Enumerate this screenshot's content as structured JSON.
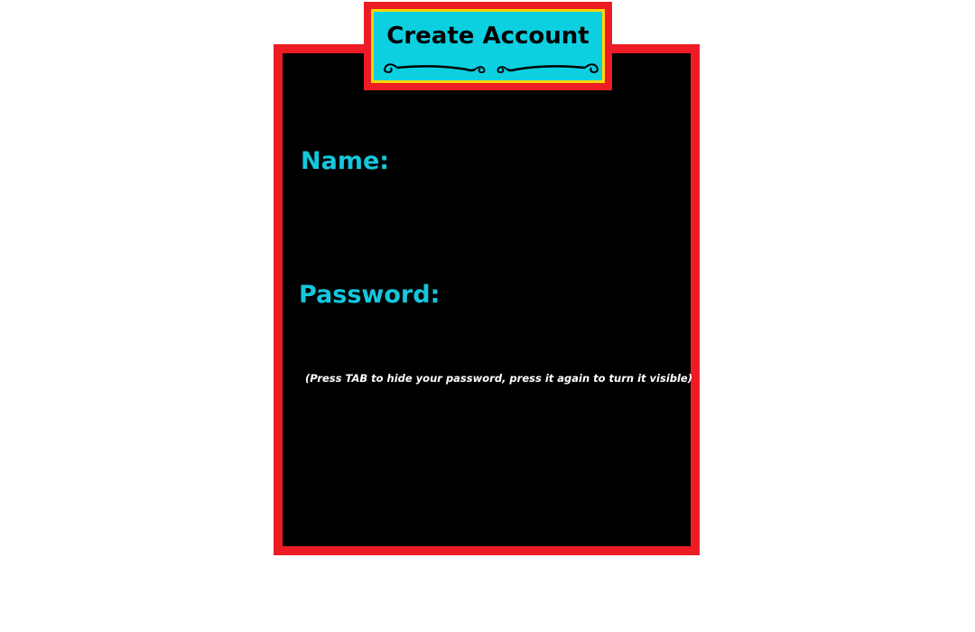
{
  "window": {
    "title": "Create Account"
  },
  "form": {
    "name_label": "Name:",
    "name_value": "",
    "password_label": "Password:",
    "password_value": "",
    "hint": "(Press TAB to hide your password, press it again to turn it visible)"
  },
  "colors": {
    "background": "#ffffff",
    "panel_fill": "#000000",
    "panel_border": "#ed1c24",
    "plaque_fill": "#0ccfe0",
    "plaque_ring": "#ffd800",
    "label_color": "#14c7dc",
    "hint_color": "#ffffff"
  },
  "icons": {
    "title_ornament": "scroll-flourish-icon"
  }
}
